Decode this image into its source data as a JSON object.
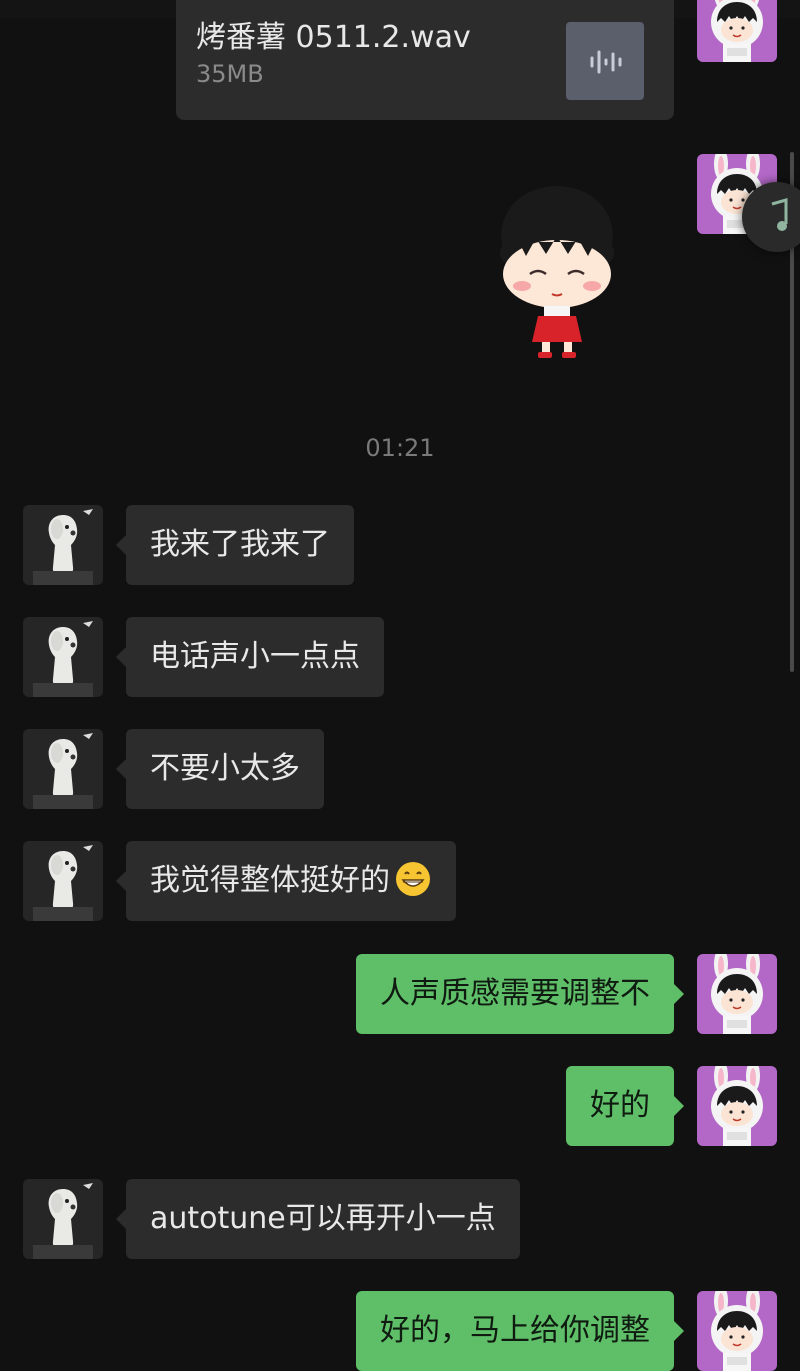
{
  "file_message": {
    "name": "烤番薯 0511.2.wav",
    "size": "35MB",
    "icon": "audio-file-icon"
  },
  "sticker": {
    "icon": "cartoon-girl-sticker"
  },
  "timestamp": "01:21",
  "messages": [
    {
      "side": "in",
      "text": "我来了我来了"
    },
    {
      "side": "in",
      "text": "电话声小一点点"
    },
    {
      "side": "in",
      "text": "不要小太多"
    },
    {
      "side": "in",
      "text": "我觉得整体挺好的",
      "emoji": "grinning-face-icon"
    },
    {
      "side": "out",
      "text": "人声质感需要调整不"
    },
    {
      "side": "out",
      "text": "好的"
    },
    {
      "side": "in",
      "text": "autotune可以再开小一点"
    },
    {
      "side": "out",
      "text": "好的，马上给你调整"
    }
  ],
  "colors": {
    "background": "#111111",
    "incoming_bubble": "#2c2c2c",
    "outgoing_bubble": "#5fbf68",
    "timestamp": "#7a7a7a"
  },
  "floating_widget": {
    "icon": "music-note-icon"
  }
}
